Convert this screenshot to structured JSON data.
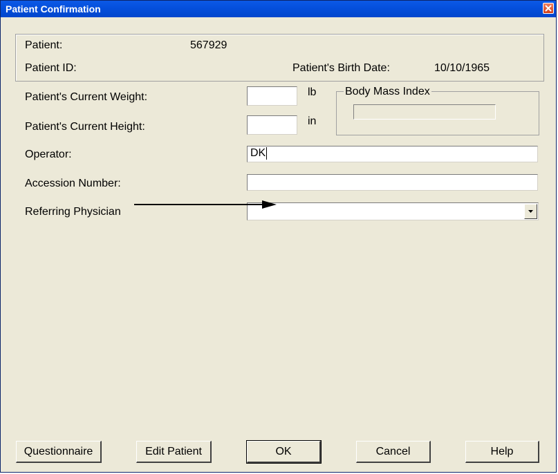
{
  "window": {
    "title": "Patient Confirmation"
  },
  "patient_info": {
    "patient_label": "Patient:",
    "patient_value": "567929",
    "patient_id_label": "Patient ID:",
    "birth_date_label": "Patient's Birth Date:",
    "birth_date_value": "10/10/1965"
  },
  "measurements": {
    "weight_label": "Patient's Current Weight:",
    "weight_value": "",
    "weight_unit": "lb",
    "height_label": "Patient's Current Height:",
    "height_value": "",
    "height_unit": "in",
    "bmi_label": "Body Mass Index",
    "bmi_value": ""
  },
  "form": {
    "operator_label": "Operator:",
    "operator_value": "DK",
    "accession_label": "Accession Number:",
    "accession_value": "",
    "referring_label": "Referring Physician",
    "referring_value": ""
  },
  "buttons": {
    "questionnaire": "Questionnaire",
    "edit_patient": "Edit Patient",
    "ok": "OK",
    "cancel": "Cancel",
    "help": "Help"
  },
  "colors": {
    "titlebar": "#0550dd",
    "window_bg": "#ece9d8",
    "close_button": "#d0401a"
  },
  "icons": {
    "close": "close-icon",
    "dropdown": "chevron-down-icon",
    "annotation": "arrow-right-icon"
  }
}
